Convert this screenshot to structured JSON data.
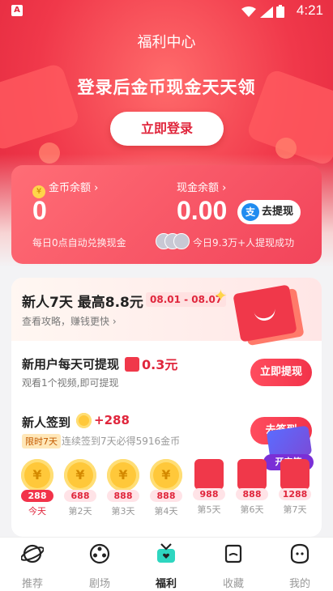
{
  "status_bar": {
    "time": "4:21",
    "app_icon": "A"
  },
  "header": {
    "title": "福利中心"
  },
  "hero": {
    "headline": "登录后金币现金天天领",
    "login_button": "立即登录"
  },
  "balance": {
    "coin_label": "金币余额 ›",
    "coin_value": "0",
    "coin_sub": "每日0点自动兑换现金",
    "cash_label": "现金余额 ›",
    "cash_value": "0.00",
    "cash_sub": "今日9.3万+人提现成功",
    "withdraw_button": "去提现",
    "withdraw_icon_char": "支"
  },
  "promo": {
    "title": "新人7天 最高8.8元",
    "date_range": "08.01 - 08.07",
    "tip": "查看攻略，赚钱更快 ›"
  },
  "new_user_task": {
    "title": "新用户每天可提现",
    "amount": "0.3元",
    "subtitle": "观看1个视频,即可提现",
    "button": "立即提现"
  },
  "checkin": {
    "title": "新人签到",
    "amount": "+288",
    "tag": "限时7天",
    "subtitle": "连续签到7天必得5916金币",
    "button": "去签到",
    "chest_label": "开宝箱",
    "coin_symbol": "¥",
    "days": [
      {
        "value": "288",
        "label": "今天",
        "type": "coin",
        "active": true
      },
      {
        "value": "688",
        "label": "第2天",
        "type": "coin"
      },
      {
        "value": "888",
        "label": "第3天",
        "type": "coin"
      },
      {
        "value": "888",
        "label": "第4天",
        "type": "coin"
      },
      {
        "value": "988",
        "label": "第5天",
        "type": "gift"
      },
      {
        "value": "888",
        "label": "第6天",
        "type": "gift"
      },
      {
        "value": "1288",
        "label": "第7天",
        "type": "gift"
      }
    ]
  },
  "bottom_nav": [
    {
      "label": "推荐",
      "icon": "planet-icon"
    },
    {
      "label": "剧场",
      "icon": "film-reel-icon"
    },
    {
      "label": "福利",
      "icon": "gift-tv-icon",
      "active": true
    },
    {
      "label": "收藏",
      "icon": "folder-icon"
    },
    {
      "label": "我的",
      "icon": "profile-face-icon"
    }
  ],
  "colors": {
    "brand_red": "#f0384a",
    "gold": "#ffc83a",
    "withdraw_blue": "#1f8cf0"
  }
}
